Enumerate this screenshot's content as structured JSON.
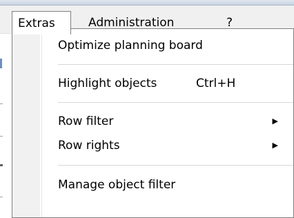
{
  "menubar": {
    "items": [
      {
        "label": "Extras"
      },
      {
        "label": "Administration"
      },
      {
        "label": "?"
      }
    ]
  },
  "menu": {
    "items": [
      {
        "label": "Optimize planning board"
      },
      {
        "label": "Highlight objects",
        "shortcut": "Ctrl+H"
      },
      {
        "label": "Row filter",
        "submenu_icon": "triangle-right-icon"
      },
      {
        "label": "Row rights",
        "submenu_icon": "triangle-right-icon"
      },
      {
        "label": "Manage object filter"
      }
    ]
  }
}
